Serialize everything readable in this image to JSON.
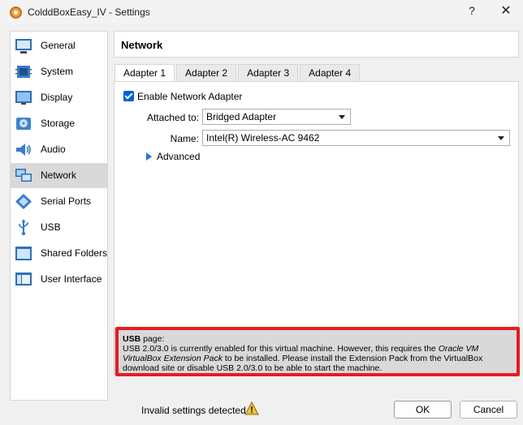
{
  "window": {
    "title": "ColddBoxEasy_IV - Settings",
    "help_label": "?",
    "close_label": "✕"
  },
  "sidebar": {
    "selected": "Network",
    "items": [
      {
        "label": "General",
        "icon": "general-icon"
      },
      {
        "label": "System",
        "icon": "system-icon"
      },
      {
        "label": "Display",
        "icon": "display-icon"
      },
      {
        "label": "Storage",
        "icon": "storage-icon"
      },
      {
        "label": "Audio",
        "icon": "audio-icon"
      },
      {
        "label": "Network",
        "icon": "network-icon"
      },
      {
        "label": "Serial Ports",
        "icon": "serial-ports-icon"
      },
      {
        "label": "USB",
        "icon": "usb-icon"
      },
      {
        "label": "Shared Folders",
        "icon": "shared-folders-icon"
      },
      {
        "label": "User Interface",
        "icon": "user-interface-icon"
      }
    ]
  },
  "panel": {
    "title": "Network",
    "tabs": [
      {
        "label": "Adapter 1",
        "active": true
      },
      {
        "label": "Adapter 2",
        "active": false
      },
      {
        "label": "Adapter 3",
        "active": false
      },
      {
        "label": "Adapter 4",
        "active": false
      }
    ],
    "enable_label": "Enable Network Adapter",
    "enable_checked": true,
    "attached_label": "Attached to:",
    "attached_value": "Bridged Adapter",
    "name_label": "Name:",
    "name_value": "Intel(R) Wireless-AC 9462",
    "advanced_label": "Advanced"
  },
  "warning": {
    "page_bold": "USB",
    "page_rest": " page:",
    "line_a": "USB 2.0/3.0 is currently enabled for this virtual machine. However, this requires the ",
    "italic": "Oracle VM VirtualBox Extension Pack",
    "line_b": " to be installed. Please install the Extension Pack from the VirtualBox download site or disable USB 2.0/3.0 to be able to start the machine.",
    "highlight_color": "#e51b24"
  },
  "footer": {
    "invalid_label": "Invalid settings detected",
    "ok_label": "OK",
    "cancel_label": "Cancel"
  }
}
